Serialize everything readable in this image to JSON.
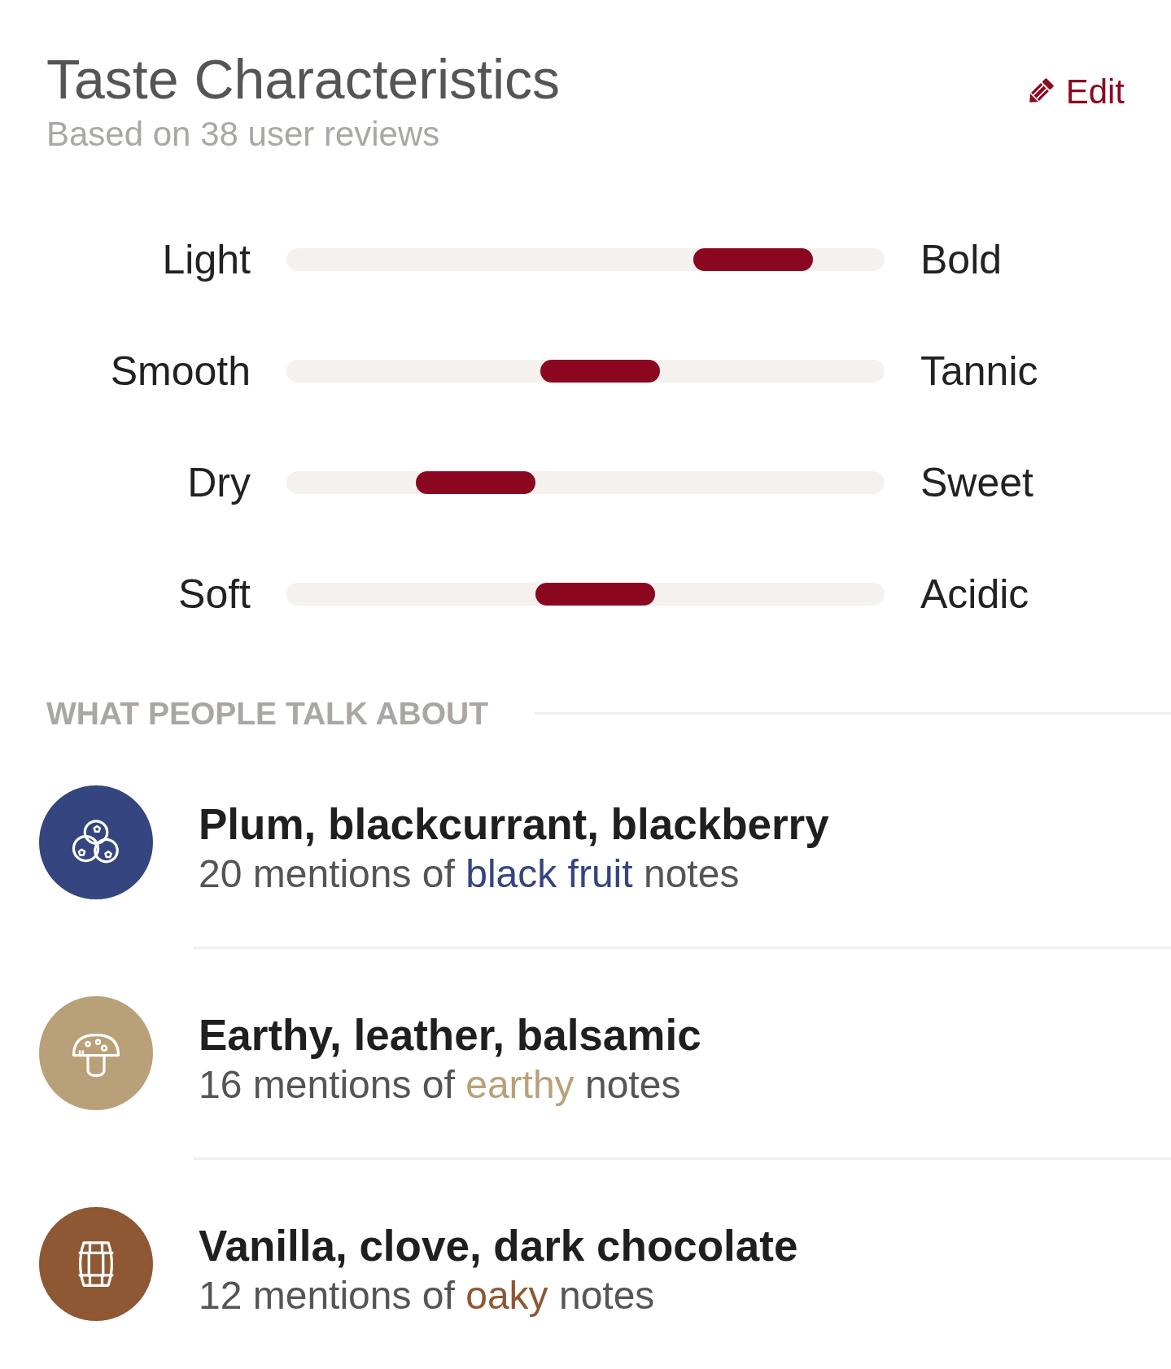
{
  "header": {
    "title": "Taste Characteristics",
    "subtitle": "Based on 38 user reviews",
    "edit_label": "Edit"
  },
  "scales": [
    {
      "left": "Light",
      "right": "Bold",
      "level": 0.85
    },
    {
      "left": "Smooth",
      "right": "Tannic",
      "level": 0.53
    },
    {
      "left": "Dry",
      "right": "Sweet",
      "level": 0.27
    },
    {
      "left": "Soft",
      "right": "Acidic",
      "level": 0.52
    }
  ],
  "talk": {
    "heading": "WHAT PEOPLE TALK ABOUT",
    "items": [
      {
        "kind": "berries",
        "color": "#34457f",
        "title": "Plum, blackcurrant, blackberry",
        "mentions": "20 mentions of",
        "note": "black fruit",
        "suffix": "notes"
      },
      {
        "kind": "mushroom",
        "color": "#b8a078",
        "title": "Earthy, leather, balsamic",
        "mentions": "16 mentions of",
        "note": "earthy",
        "suffix": "notes"
      },
      {
        "kind": "barrel",
        "color": "#8e5834",
        "title": "Vanilla, clove, dark chocolate",
        "mentions": "12 mentions of",
        "note": "oaky",
        "suffix": "notes"
      }
    ]
  }
}
